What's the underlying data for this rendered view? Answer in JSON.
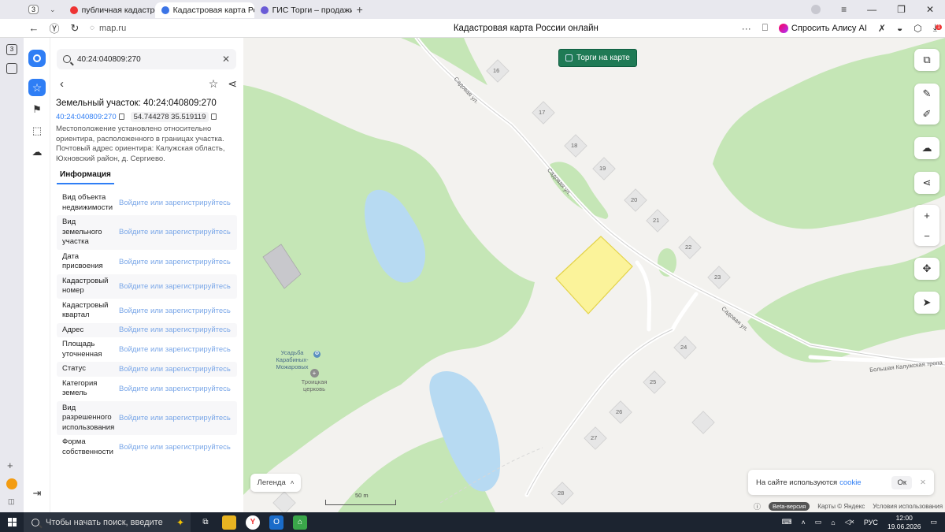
{
  "browser": {
    "tab_count": "3",
    "tabs": [
      {
        "label": "публичная кадастровая к",
        "color": "#e33"
      },
      {
        "label": "Кадастровая карта Рос",
        "color": "#3b74e6"
      },
      {
        "label": "ГИС Торги – продажи гос",
        "color": "#6a5bd6"
      }
    ],
    "url": "map.ru",
    "page_title": "Кадастровая карта России онлайн",
    "alice_label": "Спросить Алису AI",
    "download_badge": "1",
    "sidebar_badge": "3"
  },
  "panel": {
    "search_value": "40:24:040809:270",
    "title": "Земельный участок: 40:24:040809:270",
    "cad_number": "40:24:040809:270",
    "coords": "54.744278 35.519119",
    "description": "Местоположение установлено относительно ориентира, расположенного в границах участка. Почтовый адрес ориентира: Калужская область, Юхновский район, д. Сергиево.",
    "tab_info": "Информация",
    "login_text": "Войдите или зарегистрируйтесь",
    "rows": [
      {
        "key": "Вид объекта недвижимости"
      },
      {
        "key": "Вид земельного участка"
      },
      {
        "key": "Дата присвоения"
      },
      {
        "key": "Кадастровый номер"
      },
      {
        "key": "Кадастровый квартал"
      },
      {
        "key": "Адрес"
      },
      {
        "key": "Площадь уточненная"
      },
      {
        "key": "Статус"
      },
      {
        "key": "Категория земель"
      },
      {
        "key": "Вид разрешенного использования"
      },
      {
        "key": "Форма собственности"
      }
    ]
  },
  "map": {
    "torgi_label": "Торги на карте",
    "legend_label": "Легенда",
    "scale_label": "50 m",
    "beta_label": "Beta-версия",
    "yandex_label": "Карты © Яндекс",
    "terms_label": "Условия использования",
    "cookie_text": "На сайте используются",
    "cookie_link": "cookie",
    "cookie_ok": "Ок",
    "street_sadovaya_1": "Садовая ул.",
    "street_sadovaya_2": "Садовая ул.",
    "street_sadovaya_3": "Садовая ул.",
    "street_kaluzh": "Большая Калужская тропа",
    "poi_estate": "Усадьба Карабиных-Можаровых",
    "poi_church": "Троицкая церковь",
    "house_numbers": [
      "16",
      "17",
      "18",
      "19",
      "20",
      "21",
      "22",
      "23",
      "24",
      "25",
      "26",
      "27",
      "28"
    ],
    "colors": {
      "forest": "#c5e6b6",
      "water": "#b7daf2",
      "parcel": "#fbf39a",
      "parcel_border": "#e3d34a"
    }
  },
  "taskbar": {
    "search_placeholder": "Чтобы начать поиск, введите",
    "lang": "РУС",
    "time": "12:00",
    "date": "19.06.2026"
  }
}
